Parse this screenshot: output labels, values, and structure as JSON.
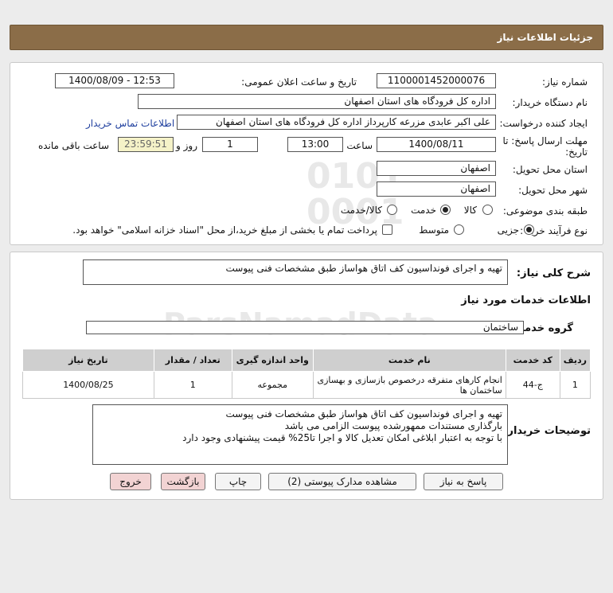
{
  "header": {
    "title": "جزئیات اطلاعات نیاز"
  },
  "form": {
    "need_number_label": "شماره نیاز:",
    "need_number": "1100001452000076",
    "announce_label": "تاریخ و ساعت اعلان عمومی:",
    "announce_value": "1400/08/09 - 12:53",
    "buyer_org_label": "نام دستگاه خریدار:",
    "buyer_org": "اداره کل فرودگاه های استان اصفهان",
    "creator_label": "ایجاد کننده درخواست:",
    "creator": "علی اکبر عابدی مزرعه کارپرداز اداره کل فرودگاه های استان اصفهان",
    "contact_link": "اطلاعات تماس خریدار",
    "deadline_label_1": "مهلت ارسال پاسخ: تا",
    "deadline_label_2": "تاریخ:",
    "deadline_date": "1400/08/11",
    "time_label": "ساعت",
    "deadline_time": "13:00",
    "days_value": "1",
    "days_label": "روز و",
    "remaining_time": "23:59:51",
    "remaining_label": "ساعت باقی مانده",
    "province_label": "استان محل تحویل:",
    "province": "اصفهان",
    "city_label": "شهر محل تحویل:",
    "city": "اصفهان",
    "category_label": "طبقه بندی موضوعی:",
    "category_options": [
      "کالا",
      "خدمت",
      "کالا/خدمت"
    ],
    "category_selected": 1,
    "process_label": "نوع فرآیند خرید :",
    "process_options": [
      "جزیی",
      "متوسط"
    ],
    "process_selected": 0,
    "payment_note": "پرداخت تمام یا بخشی از مبلغ خرید،از محل \"اسناد خزانه اسلامی\" خواهد بود."
  },
  "details": {
    "summary_label": "شرح کلی نیاز:",
    "summary": "تهیه و اجرای فونداسیون کف اتاق هواساز طبق مشخصات فنی پیوست",
    "services_heading": "اطلاعات خدمات مورد نیاز",
    "service_group_label": "گروه خدمت:",
    "service_group": "ساختمان",
    "table": {
      "headers": [
        "ردیف",
        "کد خدمت",
        "نام خدمت",
        "واحد اندازه گیری",
        "تعداد / مقدار",
        "تاریخ نیاز"
      ],
      "rows": [
        [
          "1",
          "ج-44",
          "انجام کارهای متفرقه درخصوص بازسازی و بهسازی ساختمان ها",
          "مجموعه",
          "1",
          "1400/08/25"
        ]
      ]
    },
    "buyer_desc_label": "توضیحات خریدار:",
    "buyer_desc_lines": [
      "تهیه و اجرای فونداسیون کف اتاق هواساز طبق مشخصات فنی پیوست",
      "بارگذاری مستندات ممهورشده پیوست الزامی می باشد",
      "با توجه به اعتبار ابلاغی امکان تعدیل کالا و اجرا تا25% قیمت پیشنهادی وجود دارد"
    ]
  },
  "buttons": {
    "reply": "پاسخ به نیاز",
    "view_docs": "مشاهده مدارک پیوستی (2)",
    "print": "چاپ",
    "back": "بازگشت",
    "exit": "خروج"
  }
}
